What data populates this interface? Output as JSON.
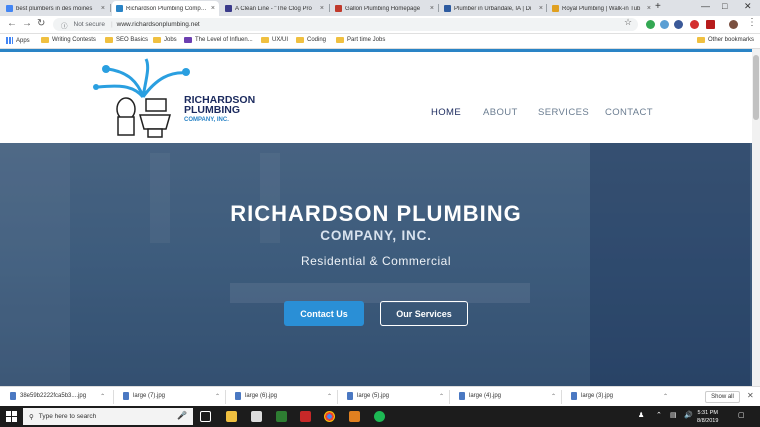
{
  "browser": {
    "tabs": [
      {
        "label": "best plumbers in des moines",
        "fav_color": "#4285f4",
        "active": false
      },
      {
        "label": "Richardson Plumbing Company",
        "fav_color": "#2a84c6",
        "active": true
      },
      {
        "label": "A Clean Line - \"The Clog Pro",
        "fav_color": "#3a3a8a",
        "active": false
      },
      {
        "label": "Gallon Plumbing Homepage",
        "fav_color": "#c0392b",
        "active": false
      },
      {
        "label": "Plumber in Urbandale, IA | Di",
        "fav_color": "#2c5aa0",
        "active": false
      },
      {
        "label": "Royal Plumbing | Walk-in Tub",
        "fav_color": "#e0a020",
        "active": false
      }
    ],
    "close_glyph": "×",
    "new_tab_glyph": "+",
    "security": "Not secure",
    "url": "www.richardsonplumbing.net",
    "bookmarks": [
      "Apps",
      "Writing Contests",
      "SEO Basics",
      "Jobs",
      "The Level of Influen...",
      "UX/UI",
      "Coding",
      "Part time Jobs"
    ],
    "other_bookmarks": "Other bookmarks"
  },
  "site": {
    "logo": {
      "line1": "RICHARDSON",
      "line2": "PLUMBING",
      "line3": "COMPANY, INC."
    },
    "nav": [
      "HOME",
      "ABOUT",
      "SERVICES",
      "CONTACT"
    ],
    "hero": {
      "title": "RICHARDSON PLUMBING",
      "subtitle": "COMPANY, INC.",
      "tagline": "Residential & Commercial",
      "primary_button": "Contact Us",
      "secondary_button": "Our Services"
    }
  },
  "downloads": {
    "items": [
      "38e59b2222fca5b3....jpg",
      "large (7).jpg",
      "large (6).jpg",
      "large (5).jpg",
      "large (4).jpg",
      "large (3).jpg"
    ],
    "show_all": "Show all"
  },
  "taskbar": {
    "search_placeholder": "Type here to search",
    "time": "5:31 PM",
    "date": "8/8/2019"
  },
  "colors": {
    "brand_blue": "#2a84c6",
    "navy": "#1b2a5e",
    "button_blue": "#2a8fd6"
  }
}
